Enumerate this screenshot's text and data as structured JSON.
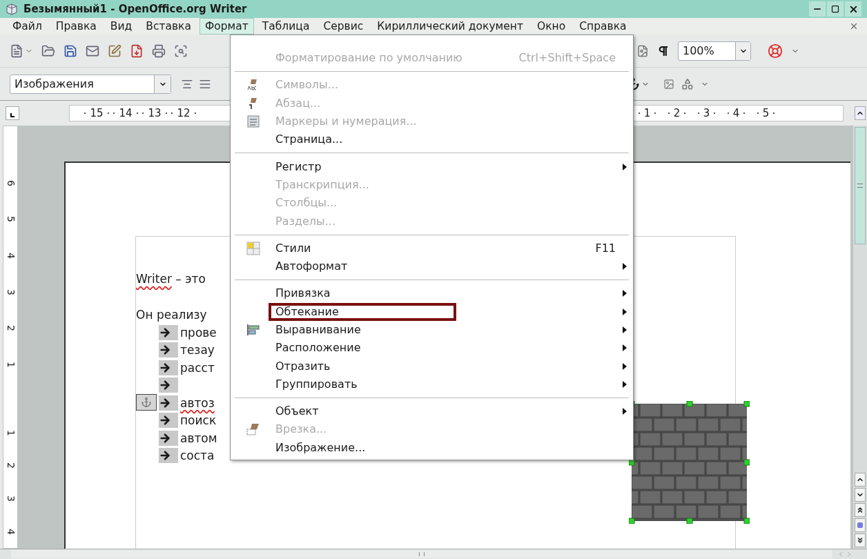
{
  "window": {
    "title": "Безымянный1 - OpenOffice.org Writer"
  },
  "menu_bar": [
    {
      "label": "Файл",
      "selected": false
    },
    {
      "label": "Правка",
      "selected": false
    },
    {
      "label": "Вид",
      "selected": false
    },
    {
      "label": "Вставка",
      "selected": false
    },
    {
      "label": "Формат",
      "selected": true
    },
    {
      "label": "Таблица",
      "selected": false
    },
    {
      "label": "Сервис",
      "selected": false
    },
    {
      "label": "Кириллический документ",
      "selected": false
    },
    {
      "label": "Окно",
      "selected": false
    },
    {
      "label": "Справка",
      "selected": false
    }
  ],
  "standard_toolbar": {
    "zoom": "100%"
  },
  "formatting_toolbar": {
    "style": "Изображения"
  },
  "ruler": {
    "left_numbers": [
      "15",
      "14",
      "13",
      "12"
    ],
    "right_numbers": [
      "1",
      "2",
      "3",
      "4",
      "5"
    ]
  },
  "vertical_ruler": {
    "above": [
      "6",
      "5",
      "4",
      "3",
      "2",
      "1"
    ],
    "below": [
      "1",
      "2",
      "3",
      "4"
    ]
  },
  "document": {
    "paragraphs": [
      {
        "runs": [
          {
            "text": "Writer",
            "misspelled": true
          },
          {
            "text": " – это",
            "misspelled": false
          }
        ]
      },
      {
        "runs": [
          {
            "text": "Он реализу",
            "misspelled": false
          }
        ]
      }
    ],
    "list_items": [
      {
        "kind": "text",
        "text": "прове",
        "misspelled": false,
        "anchored": false
      },
      {
        "kind": "text",
        "text": "тезау",
        "misspelled": false,
        "anchored": false
      },
      {
        "kind": "text",
        "text": "расст",
        "misspelled": false,
        "anchored": false
      },
      {
        "kind": "empty",
        "anchored": false
      },
      {
        "kind": "text",
        "text": "автоз",
        "misspelled": true,
        "anchored": true
      },
      {
        "kind": "text",
        "text": "поиск",
        "misspelled": false,
        "anchored": false
      },
      {
        "kind": "text",
        "text": "автом",
        "misspelled": false,
        "anchored": false
      },
      {
        "kind": "text",
        "text": "соста",
        "misspelled": false,
        "anchored": false
      }
    ]
  },
  "format_menu": {
    "items": [
      {
        "kind": "item",
        "label": "Форматирование по умолчанию",
        "shortcut": "Ctrl+Shift+Space",
        "disabled": true,
        "submenu": false
      },
      {
        "kind": "separator"
      },
      {
        "kind": "icon_item",
        "label": "Символы...",
        "disabled": true,
        "submenu": false
      },
      {
        "kind": "icon_item",
        "label": "Абзац...",
        "disabled": true,
        "submenu": false
      },
      {
        "kind": "icon_item",
        "label": "Маркеры и нумерация...",
        "disabled": true,
        "submenu": false
      },
      {
        "kind": "item",
        "label": "Страница...",
        "disabled": false,
        "submenu": false
      },
      {
        "kind": "separator"
      },
      {
        "kind": "item",
        "label": "Регистр",
        "disabled": false,
        "submenu": true
      },
      {
        "kind": "item",
        "label": "Транскрипция...",
        "disabled": true,
        "submenu": false
      },
      {
        "kind": "item",
        "label": "Столбцы...",
        "disabled": true,
        "submenu": false
      },
      {
        "kind": "item",
        "label": "Разделы...",
        "disabled": true,
        "submenu": false
      },
      {
        "kind": "separator"
      },
      {
        "kind": "icon_item",
        "label": "Стили",
        "shortcut": "F11",
        "disabled": false,
        "submenu": false
      },
      {
        "kind": "item",
        "label": "Автоформат",
        "disabled": false,
        "submenu": true
      },
      {
        "kind": "separator"
      },
      {
        "kind": "item",
        "label": "Привязка",
        "disabled": false,
        "submenu": true
      },
      {
        "kind": "item",
        "label": "Обтекание",
        "disabled": false,
        "submenu": true,
        "highlighted": true
      },
      {
        "kind": "icon_item",
        "label": "Выравнивание",
        "disabled": false,
        "submenu": true
      },
      {
        "kind": "item",
        "label": "Расположение",
        "disabled": false,
        "submenu": true
      },
      {
        "kind": "item",
        "label": "Отразить",
        "disabled": false,
        "submenu": true
      },
      {
        "kind": "item",
        "label": "Группировать",
        "disabled": false,
        "submenu": true
      },
      {
        "kind": "separator"
      },
      {
        "kind": "item",
        "label": "Объект",
        "disabled": false,
        "submenu": true
      },
      {
        "kind": "icon_item",
        "label": "Врезка...",
        "disabled": true,
        "submenu": false
      },
      {
        "kind": "item",
        "label": "Изображение...",
        "disabled": false,
        "submenu": false
      }
    ]
  }
}
